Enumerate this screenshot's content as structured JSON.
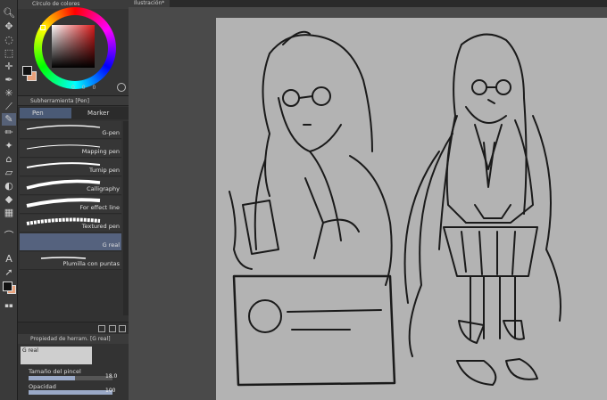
{
  "color_panel": {
    "title": "Círculo de colores",
    "values": [
      "0",
      "0",
      "0"
    ]
  },
  "subtool": {
    "title": "Subherramienta [Pen]",
    "tabs": [
      {
        "label": "Pen"
      },
      {
        "label": "Marker"
      }
    ],
    "brushes": [
      {
        "name": "G-pen"
      },
      {
        "name": "Mapping pen"
      },
      {
        "name": "Turnip pen"
      },
      {
        "name": "Calligraphy"
      },
      {
        "name": "For effect line"
      },
      {
        "name": "Textured pen"
      },
      {
        "name": "G real"
      },
      {
        "name": "Plumilla con puntas"
      }
    ],
    "selected_brush": "G real"
  },
  "tool_property": {
    "title": "Propiedad de herram. [G real]",
    "preset_name": "G real",
    "brush_size_label": "Tamaño del pincel",
    "brush_size_value": "18.0",
    "brush_size": 0.55,
    "opacity_label": "Opacidad",
    "opacity_value": "100",
    "opacity": 1.0
  },
  "document": {
    "tab_title": "Ilustración*"
  },
  "colors": {
    "accent": "#55627e",
    "canvas": "#b3b3b3",
    "bg_color": "#e8a07a"
  }
}
